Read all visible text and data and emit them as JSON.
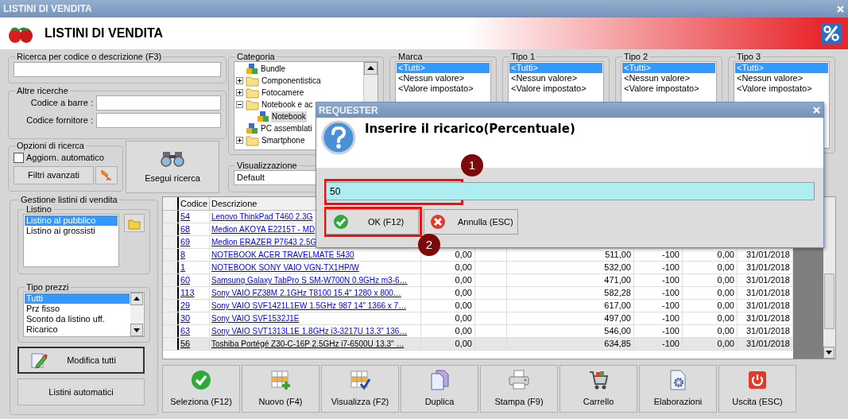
{
  "window": {
    "title": "LISTINI DI VENDITA"
  },
  "header": {
    "title": "LISTINI DI VENDITA"
  },
  "search": {
    "label": "Ricerca per codice o descrizione (F3)"
  },
  "other_searches": {
    "label": "Altre ricerche",
    "fields": [
      {
        "label": "Codice a barre :"
      },
      {
        "label": "Codice fornitore :"
      }
    ]
  },
  "search_options": {
    "label": "Opzioni di ricerca",
    "auto_update": {
      "label": "Aggiorn. automatico",
      "checked": false
    },
    "advanced_button": "Filtri avanzati"
  },
  "run_search_button": "Esegui ricerca",
  "category": {
    "label": "Categoria",
    "tree": [
      {
        "label": "Bundle",
        "kind": "bundle",
        "selected": false
      },
      {
        "label": "Componentistica",
        "kind": "folder",
        "expanded": false,
        "selected": false
      },
      {
        "label": "Fotocamere",
        "kind": "folder",
        "expanded": false,
        "selected": false
      },
      {
        "label": "Notebook e ac",
        "kind": "folder",
        "expanded": true,
        "selected": false,
        "children": [
          {
            "label": "Notebook",
            "kind": "bundle",
            "selected": true
          }
        ]
      },
      {
        "label": "PC assemblati",
        "kind": "bundle",
        "selected": false
      },
      {
        "label": "Smartphone",
        "kind": "folder",
        "expanded": false,
        "selected": false
      }
    ]
  },
  "view": {
    "label": "Visualizzazione",
    "value": "Default"
  },
  "filters": [
    {
      "label": "Marca",
      "options": [
        {
          "label": "<Tutti>",
          "selected": true
        },
        {
          "label": "<Nessun valore>",
          "selected": false
        },
        {
          "label": "<Valore impostato>",
          "selected": false
        }
      ]
    },
    {
      "label": "Tipo 1",
      "options": [
        {
          "label": "<Tutti>",
          "selected": true
        },
        {
          "label": "<Nessun valore>",
          "selected": false
        },
        {
          "label": "<Valore impostato>",
          "selected": false
        }
      ]
    },
    {
      "label": "Tipo 2",
      "options": [
        {
          "label": "<Tutti>",
          "selected": true
        },
        {
          "label": "<Nessun valore>",
          "selected": false
        },
        {
          "label": "<Valore impostato>",
          "selected": false
        }
      ]
    },
    {
      "label": "Tipo 3",
      "options": [
        {
          "label": "<Tutti>",
          "selected": true
        },
        {
          "label": "<Nessun valore>",
          "selected": false
        },
        {
          "label": "<Valore impostato>",
          "selected": false
        }
      ]
    }
  ],
  "price_lists": {
    "label": "Gestione listini di vendita",
    "listino": {
      "label": "Listino",
      "items": [
        {
          "label": "Listino al pubblico",
          "selected": true
        },
        {
          "label": "Listino ai grossisti",
          "selected": false
        }
      ]
    },
    "price_types": {
      "label": "Tipo prezzi",
      "items": [
        {
          "label": "Tutti",
          "selected": true
        },
        {
          "label": "Prz fisso",
          "selected": false
        },
        {
          "label": "Sconto da listino uff.",
          "selected": false
        },
        {
          "label": "Ricarico",
          "selected": false
        }
      ]
    },
    "edit_all_button": "Modifica tutti",
    "auto_lists_button": "Listini automatici"
  },
  "table": {
    "columns": [
      "Codice",
      "Descrizione"
    ],
    "rows": [
      {
        "codice": "54",
        "descrizione": "Lenovo ThinkPad T460 2.3G",
        "selected": false
      },
      {
        "codice": "68",
        "descrizione": "Medion AKOYA E2215T - MD",
        "selected": false
      },
      {
        "codice": "69",
        "descrizione": "Medion ERAZER P7643 2.5G",
        "selected": false
      },
      {
        "codice": "8",
        "descrizione": "NOTEBOOK ACER TRAVELMATE 5430",
        "column_3": "0,00",
        "column_5": "511,00",
        "column_6": "-100",
        "column_7": "0,00",
        "column_8": "31/01/2018",
        "selected": false
      },
      {
        "codice": "1",
        "descrizione": "NOTEBOOK SONY VAIO VGN-TX1HP/W",
        "column_3": "0,00",
        "column_5": "532,00",
        "column_6": "-100",
        "column_7": "0,00",
        "column_8": "31/01/2018",
        "selected": false
      },
      {
        "codice": "60",
        "descrizione": "Samsung Galaxy TabPro S SM-W700N 0.9GHz m3-6…",
        "column_3": "0,00",
        "column_5": "471,00",
        "column_6": "-100",
        "column_7": "0,00",
        "column_8": "31/01/2018",
        "selected": false
      },
      {
        "codice": "113",
        "descrizione": "Sony VAIO FZ38M 2.1GHz T8100 15.4\" 1280 x 800…",
        "column_3": "0,00",
        "column_5": "582,28",
        "column_6": "-100",
        "column_7": "0,00",
        "column_8": "31/01/2018",
        "selected": false
      },
      {
        "codice": "29",
        "descrizione": "Sony VAIO SVF1421L1EW 1.5GHz 987 14\" 1366 x 7…",
        "column_3": "0,00",
        "column_5": "617,00",
        "column_6": "-100",
        "column_7": "0,00",
        "column_8": "31/01/2018",
        "selected": false
      },
      {
        "codice": "30",
        "descrizione": "Sony VAIO SVF1532J1E",
        "column_3": "0,00",
        "column_5": "497,00",
        "column_6": "-100",
        "column_7": "0,00",
        "column_8": "31/01/2018",
        "selected": false
      },
      {
        "codice": "63",
        "descrizione": "Sony VAIO SVT1313L1E 1.8GHz i3-3217U 13.3\" 136…",
        "column_3": "0,00",
        "column_5": "546,00",
        "column_6": "-100",
        "column_7": "0,00",
        "column_8": "31/01/2018",
        "selected": false
      },
      {
        "codice": "56",
        "descrizione": "Toshiba Portégé Z30-C-16P 2.5GHz i7-6500U 13.3\" …",
        "column_3": "0,00",
        "column_5": "634,85",
        "column_6": "-100",
        "column_7": "0,00",
        "column_8": "31/01/2018",
        "selected": true
      }
    ]
  },
  "toolbar": [
    {
      "label": "Seleziona (F12)",
      "kind": "check"
    },
    {
      "label": "Nuovo (F4)",
      "kind": "new"
    },
    {
      "label": "Visualizza (F2)",
      "kind": "view"
    },
    {
      "label": "Duplica",
      "kind": "duplicate"
    },
    {
      "label": "Stampa (F9)",
      "kind": "print"
    },
    {
      "label": "Carrello",
      "kind": "cart"
    },
    {
      "label": "Elaborazioni",
      "kind": "process"
    },
    {
      "label": "Uscita (ESC)",
      "kind": "exit"
    }
  ],
  "dialog": {
    "title": "REQUESTER",
    "message": "Inserire il ricarico(Percentuale)",
    "value": "50",
    "ok_button": "OK (F12)",
    "cancel_button": "Annulla (ESC)"
  },
  "callouts": [
    {
      "number": "1"
    },
    {
      "number": "2"
    }
  ]
}
